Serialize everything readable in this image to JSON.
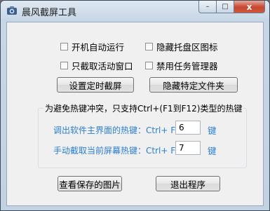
{
  "window": {
    "title": "晨风截屏工具",
    "close_glyph": "x",
    "max_glyph": "□",
    "min_glyph": "–"
  },
  "options": {
    "autostart": {
      "label": "开机自动运行",
      "checked": false
    },
    "hide_tray": {
      "label": "隐藏托盘区图标",
      "checked": false
    },
    "active_window_only": {
      "label": "只截取活动窗口",
      "checked": false
    },
    "disable_taskmgr": {
      "label": "禁用任务管理器",
      "checked": false
    }
  },
  "buttons": {
    "set_timer": "设置定时截屏",
    "hide_folder": "隐藏特定文件夹",
    "view_saved": "查看保存的图片",
    "exit": "退出程序"
  },
  "hotkeys": {
    "group_label": "为避免热键冲突，只支持Ctrl+(F1到F12)类型的热键",
    "main_ui_label": "调出软件主界面的热键：Ctrl+ F",
    "main_ui_value": "6",
    "capture_label": "手动截取当前屏幕热键：Ctrl+ F",
    "capture_value": "7",
    "suffix": "键"
  },
  "colors": {
    "accent_text": "#2b7fd1",
    "close_button": "#c7462f"
  },
  "icons": {
    "app": "camera-icon"
  }
}
